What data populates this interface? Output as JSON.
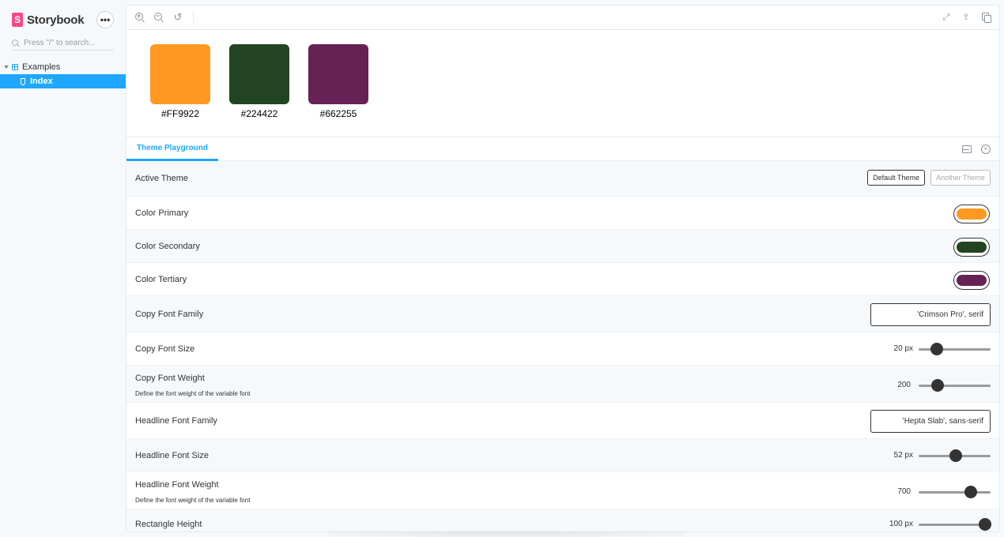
{
  "app": {
    "brand": "Storybook",
    "brand_mark": "S",
    "menu_label": "•••"
  },
  "sidebar": {
    "search_placeholder": "Press \"/\" to search...",
    "group": "Examples",
    "item": "Index"
  },
  "toolbar": {
    "zoom_in_sign": "+",
    "zoom_out_sign": "−",
    "reset_symbol": "↺",
    "fullscreen_symbol": "⤢",
    "share_symbol": "⇪"
  },
  "canvas": {
    "swatches": [
      {
        "color": "#FF9922",
        "label": "#FF9922"
      },
      {
        "color": "#224422",
        "label": "#224422"
      },
      {
        "color": "#662255",
        "label": "#662255"
      }
    ]
  },
  "panel": {
    "tab": "Theme Playground",
    "close_symbol": "×"
  },
  "controls": {
    "active_theme": {
      "label": "Active Theme",
      "options": [
        "Default Theme",
        "Another Theme"
      ],
      "selected": "Default Theme"
    },
    "color_primary": {
      "label": "Color Primary",
      "value": "#FF9922"
    },
    "color_secondary": {
      "label": "Color Secondary",
      "value": "#224422"
    },
    "color_tertiary": {
      "label": "Color Tertiary",
      "value": "#662255"
    },
    "copy_font_family": {
      "label": "Copy Font Family",
      "value": "'Crimson Pro', serif"
    },
    "copy_font_size": {
      "label": "Copy Font Size",
      "value_text": "20 px",
      "fraction": 0.25
    },
    "copy_font_weight": {
      "label": "Copy Font Weight",
      "description": "Define the font weight of the variable font",
      "value_text": "200",
      "fraction": 0.26
    },
    "headline_font_family": {
      "label": "Headline Font Family",
      "value": "'Hepta Slab', sans-serif"
    },
    "headline_font_size": {
      "label": "Headline Font Size",
      "value_text": "52 px",
      "fraction": 0.52
    },
    "headline_font_weight": {
      "label": "Headline Font Weight",
      "description": "Define the font weight of the variable font",
      "value_text": "700",
      "fraction": 0.73
    },
    "rectangle_height": {
      "label": "Rectangle Height",
      "value_text": "100 px",
      "fraction": 0.92
    }
  }
}
